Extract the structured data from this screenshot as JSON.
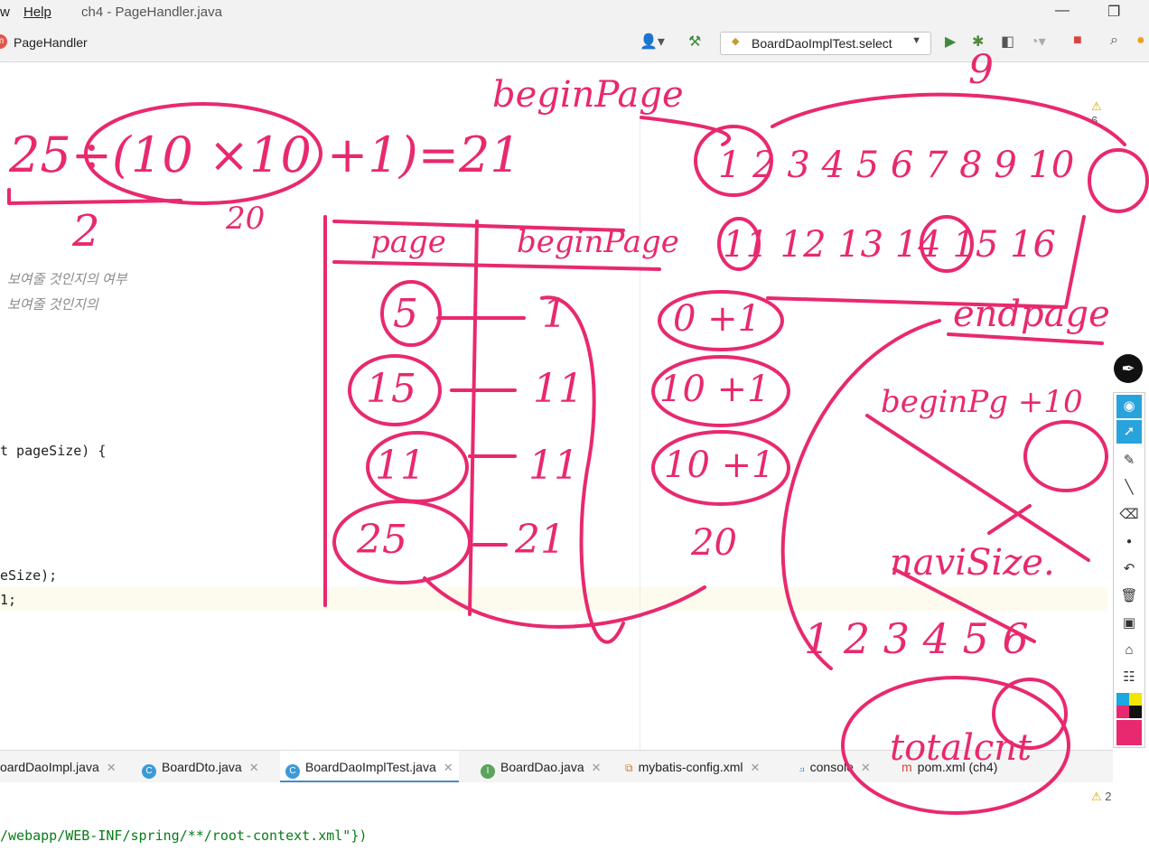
{
  "titlebar": {
    "menu_view_tail": "w",
    "menu_help": "Help",
    "window_title": "ch4 - PageHandler.java"
  },
  "navbar": {
    "file_badge": "m",
    "file_name": "PageHandler",
    "run_config": "BoardDaoImplTest.select"
  },
  "editor": {
    "warnings_top": "6",
    "warnings_bottom": "2",
    "lines": {
      "comment1": "보여줄 것인지의 여부",
      "comment2": "보여줄 것인지의",
      "method_sig": "t pageSize) {",
      "line_esize": "eSize);",
      "line_1": "1;"
    }
  },
  "tabs": [
    {
      "label": "oardDaoImpl.java",
      "icon": "",
      "active": false
    },
    {
      "label": "BoardDto.java",
      "icon": "C",
      "active": false
    },
    {
      "label": "BoardDaoImplTest.java",
      "icon": "C",
      "active": true
    },
    {
      "label": "BoardDao.java",
      "icon": "I",
      "active": false
    },
    {
      "label": "mybatis-config.xml",
      "icon": "xml",
      "active": false
    },
    {
      "label": "console",
      "icon": "",
      "active": false
    },
    {
      "label": "pom.xml (ch4)",
      "icon": "",
      "active": false
    }
  ],
  "bottom_code": "/webapp/WEB-INF/spring/**/root-context.xml\"})",
  "ink": {
    "top_left": "25÷(10 ×10 +1)=21",
    "label_2": "2",
    "label_20": "20",
    "begin_page_top": "beginPage",
    "count_9": "9",
    "row1": "1 2 3 4 5 6 7 8 9 10",
    "row2": "11 12 13 14 15 16",
    "table_head_page": "page",
    "table_head_begin": "beginPage",
    "table_pages": [
      "5",
      "15",
      "11",
      "25"
    ],
    "table_begins": [
      "1",
      "11",
      "11",
      "21"
    ],
    "table_calc": [
      "0 +1",
      "10 +1",
      "10 +1",
      "20"
    ],
    "endpage": "endpage",
    "begin_plus": "beginPg +10",
    "navisize": "naviSize.",
    "bottom_nums": "1 2 3 4 5 6",
    "bottom_word": "totalcnt"
  },
  "colors": {
    "ink": "#e8296f",
    "accent_tab": "#4a88c7",
    "warning": "#d6a400",
    "pen_selected": "#29a3dc"
  }
}
